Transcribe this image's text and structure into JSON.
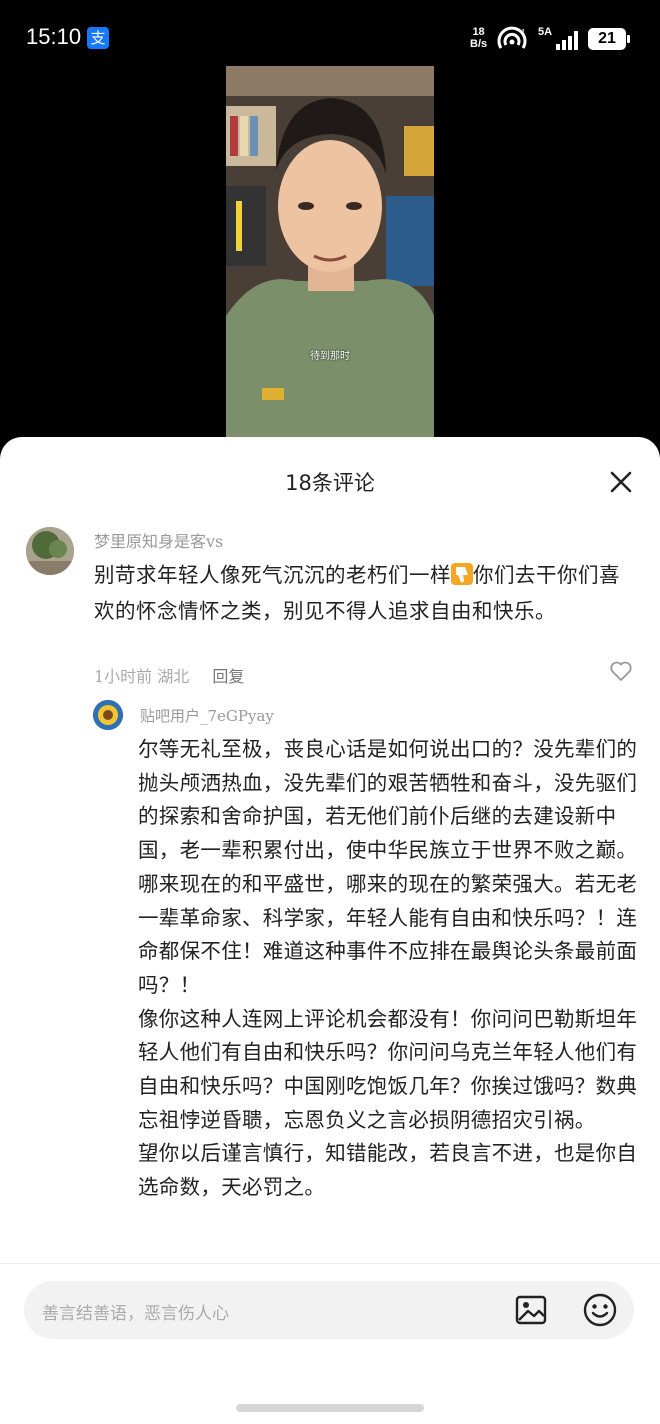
{
  "status_bar": {
    "time": "15:10",
    "app_badge": "支",
    "net_speed_value": "18",
    "net_speed_unit": "B/s",
    "signal_label": "5A",
    "battery": "21"
  },
  "video": {
    "subtitle": "待到那时"
  },
  "comments_panel": {
    "title": "18条评论"
  },
  "comment": {
    "username": "梦里原知身是客vs",
    "text_part1": "别苛求年轻人像死气沉沉的老朽们一样",
    "emoji": "thumbs-down-icon",
    "text_part2": "你们去干你们喜欢的怀念情怀之类，别见不得人追求自由和快乐。",
    "time": "1小时前",
    "location": "湖北",
    "reply_label": "回复"
  },
  "reply": {
    "username": "贴吧用户_7eGPyay",
    "paragraphs": [
      "尔等无礼至极，丧良心话是如何说出口的？没先辈们的抛头颅洒热血，没先辈们的艰苦牺牲和奋斗，没先驱们的探索和舍命护国，若无他们前仆后继的去建设新中国，老一辈积累付出，使中华民族立于世界不败之巅。哪来现在的和平盛世，哪来的现在的繁荣强大。若无老一辈革命家、科学家，年轻人能有自由和快乐吗？！连命都保不住！难道这种事件不应排在最舆论头条最前面吗？！",
      "像你这种人连网上评论机会都没有！你问问巴勒斯坦年轻人他们有自由和快乐吗？你问问乌克兰年轻人他们有自由和快乐吗？中国刚吃饱饭几年？你挨过饿吗？数典忘祖悖逆昏聩，忘恩负义之言必损阴德招灾引祸。",
      "望你以后谨言慎行，知错能改，若良言不进，也是你自选命数，天必罚之。"
    ]
  },
  "input": {
    "placeholder": "善言结善语，恶言伤人心"
  }
}
